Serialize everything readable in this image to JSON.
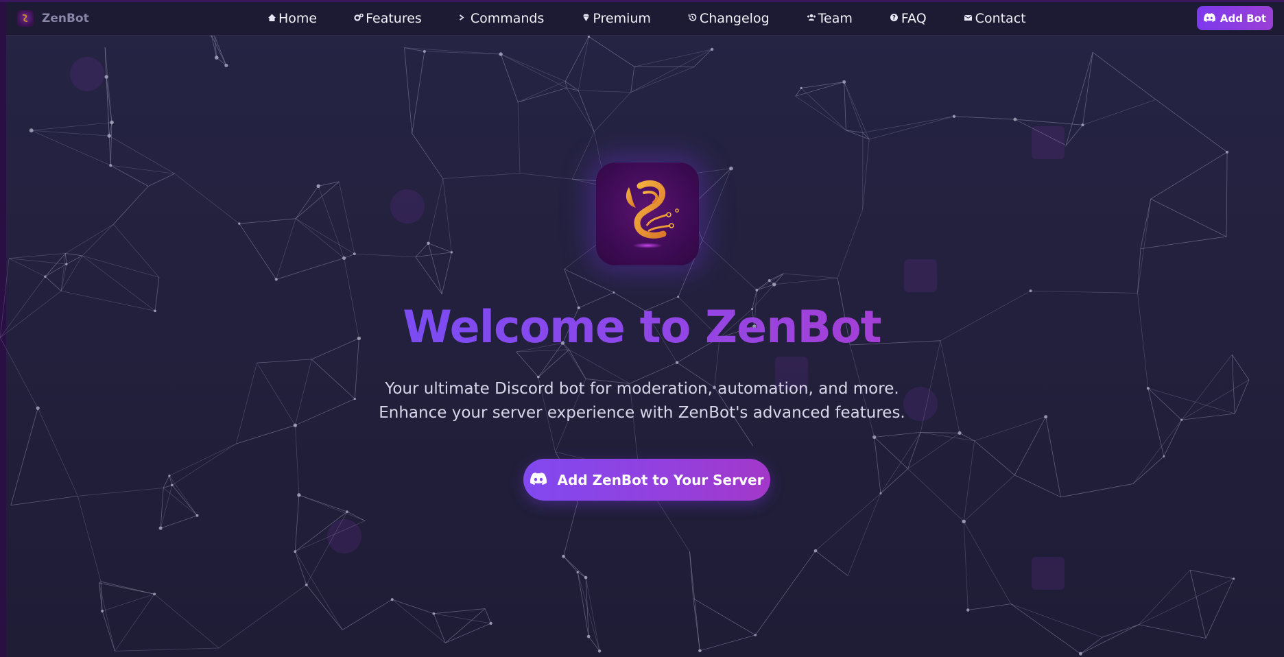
{
  "nav": {
    "brand": "ZenBot",
    "links": [
      {
        "label": "Home",
        "icon": "home-icon"
      },
      {
        "label": "Features",
        "icon": "gears-icon"
      },
      {
        "label": "Commands",
        "icon": "terminal-icon"
      },
      {
        "label": "Premium",
        "icon": "diamond-icon"
      },
      {
        "label": "Changelog",
        "icon": "history-icon"
      },
      {
        "label": "Team",
        "icon": "users-icon"
      },
      {
        "label": "FAQ",
        "icon": "question-icon"
      },
      {
        "label": "Contact",
        "icon": "envelope-icon"
      }
    ],
    "cta_label": "Add Bot",
    "cta_icon": "discord-icon"
  },
  "hero": {
    "title": "Welcome to ZenBot",
    "subtitle_line1": "Your ultimate Discord bot for moderation, automation, and more.",
    "subtitle_line2": "Enhance your server experience with ZenBot's advanced features.",
    "cta_label": "Add ZenBot to Your Server",
    "cta_icon": "discord-icon"
  },
  "colors": {
    "background": "#24223f",
    "nav_background": "#1d1b33",
    "accent_start": "#7c3aed",
    "accent_end": "#a338c9",
    "logo_glyph": "#f0a030"
  }
}
